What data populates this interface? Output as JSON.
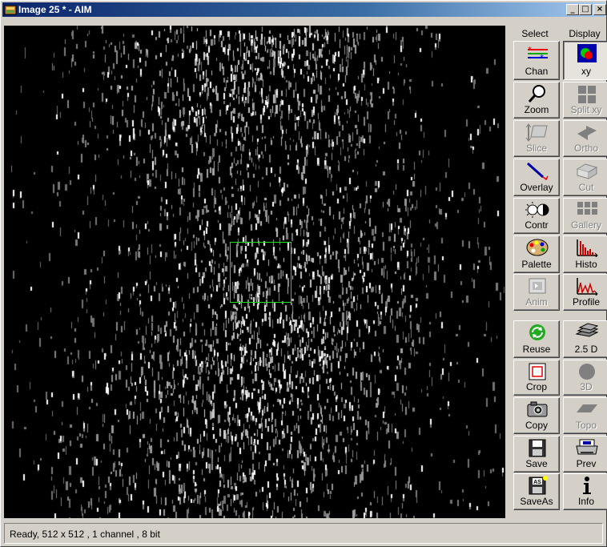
{
  "window": {
    "title": "Image 25 * - AIM",
    "minimize_glyph": "_",
    "maximize_glyph": "□",
    "close_glyph": "×"
  },
  "select_panel": {
    "header": "Select",
    "tools": [
      {
        "id": "chan",
        "label": "Chan",
        "icon": "channels-icon",
        "enabled": true
      },
      {
        "id": "zoom",
        "label": "Zoom",
        "icon": "magnifier-icon",
        "enabled": true
      },
      {
        "id": "slice",
        "label": "Slice",
        "icon": "slice-icon",
        "enabled": false
      },
      {
        "id": "overlay",
        "label": "Overlay",
        "icon": "pen-icon",
        "enabled": true
      },
      {
        "id": "contr",
        "label": "Contr",
        "icon": "contrast-icon",
        "enabled": true
      },
      {
        "id": "palette",
        "label": "Palette",
        "icon": "palette-icon",
        "enabled": true
      },
      {
        "id": "anim",
        "label": "Anim",
        "icon": "film-icon",
        "enabled": false
      },
      {
        "id": "reuse",
        "label": "Reuse",
        "icon": "recycle-icon",
        "enabled": true
      },
      {
        "id": "crop",
        "label": "Crop",
        "icon": "crop-icon",
        "enabled": true
      },
      {
        "id": "copy",
        "label": "Copy",
        "icon": "camera-icon",
        "enabled": true
      },
      {
        "id": "save",
        "label": "Save",
        "icon": "floppy-icon",
        "enabled": true
      },
      {
        "id": "saveas",
        "label": "SaveAs",
        "icon": "floppy-as-icon",
        "floppy_text": "AS",
        "enabled": true
      }
    ]
  },
  "display_panel": {
    "header": "Display",
    "tools": [
      {
        "id": "xy",
        "label": "xy",
        "icon": "xy-image-icon",
        "enabled": true,
        "active": true
      },
      {
        "id": "splitxy",
        "label": "Split xy",
        "icon": "split-grid-icon",
        "enabled": false
      },
      {
        "id": "ortho",
        "label": "Ortho",
        "icon": "ortho-icon",
        "enabled": false
      },
      {
        "id": "cut",
        "label": "Cut",
        "icon": "cut-icon",
        "enabled": false
      },
      {
        "id": "gallery",
        "label": "Gallery",
        "icon": "gallery-grid-icon",
        "enabled": false
      },
      {
        "id": "histo",
        "label": "Histo",
        "icon": "histogram-icon",
        "enabled": true
      },
      {
        "id": "profile",
        "label": "Profile",
        "icon": "profile-icon",
        "enabled": true
      },
      {
        "id": "25d",
        "label": "2.5 D",
        "icon": "stack-icon",
        "enabled": true
      },
      {
        "id": "3d",
        "label": "3D",
        "icon": "sphere-icon",
        "enabled": false
      },
      {
        "id": "topo",
        "label": "Topo",
        "icon": "topo-icon",
        "enabled": false
      },
      {
        "id": "prev",
        "label": "Prev",
        "icon": "printer-icon",
        "enabled": true
      },
      {
        "id": "info",
        "label": "Info",
        "icon": "info-icon",
        "enabled": true
      }
    ]
  },
  "colors": {
    "roi": "#1ee01e",
    "image_background": "#000000"
  },
  "status": {
    "text": "Ready, 512 x 512 , 1 channel , 8 bit"
  }
}
